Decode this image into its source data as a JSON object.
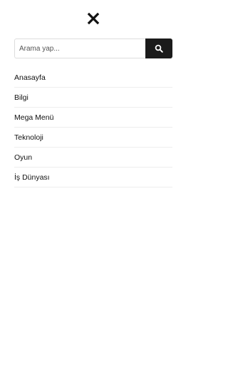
{
  "close": {
    "icon": "close-icon"
  },
  "search": {
    "placeholder": "Arama yap...",
    "value": "",
    "button_icon": "search-icon"
  },
  "menu": {
    "items": [
      {
        "label": "Anasayfa"
      },
      {
        "label": "Bilgi"
      },
      {
        "label": "Mega Menü"
      },
      {
        "label": "Teknoloji"
      },
      {
        "label": "Oyun"
      },
      {
        "label": "İş Dünyası"
      }
    ]
  },
  "colors": {
    "search_button_bg": "#1b1b1b",
    "divider": "#eeeeee",
    "text": "#111111"
  }
}
